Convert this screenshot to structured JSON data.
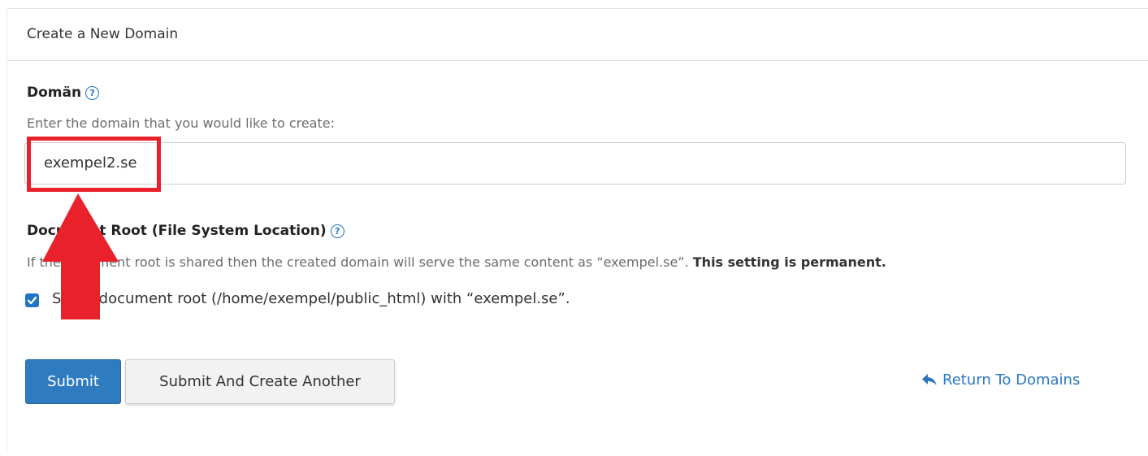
{
  "panel": {
    "title": "Create a New Domain"
  },
  "domain_field": {
    "label": "Domän",
    "help_icon": "question-circle-icon",
    "help_text": "Enter the domain that you would like to create:",
    "value": "exempel2.se"
  },
  "docroot_field": {
    "label": "Document Root (File System Location)",
    "help_icon": "question-circle-icon",
    "help_text": "If the document root is shared then the created domain will serve the same content as “exempel.se”.",
    "help_text_bold": "This setting is permanent.",
    "checkbox_checked": true,
    "checkbox_label": "Share document root (/home/exempel/public_html) with “exempel.se”."
  },
  "actions": {
    "submit_label": "Submit",
    "submit_another_label": "Submit And Create Another",
    "return_label": "Return To Domains",
    "return_icon": "reply-icon"
  },
  "annotation": {
    "highlight_color": "#e8212a",
    "arrow_icon": "up-arrow-icon"
  },
  "colors": {
    "accent": "#2f7bc0",
    "link": "#2a77c0"
  }
}
